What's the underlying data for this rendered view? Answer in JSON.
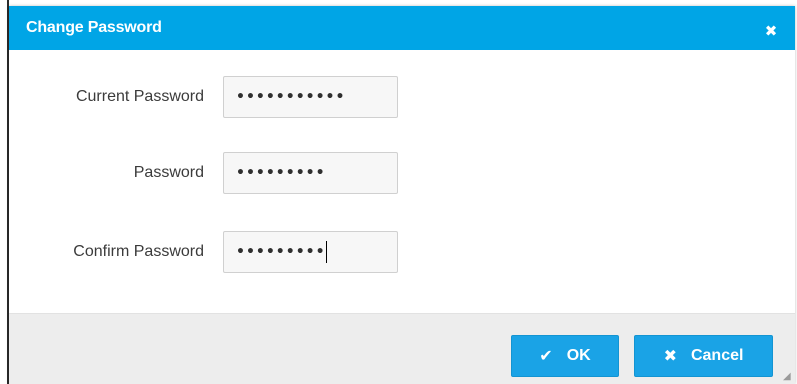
{
  "dialog": {
    "title": "Change Password",
    "close_glyph": "✖",
    "fields": [
      {
        "label": "Current Password",
        "masked_value": "•••••••••••"
      },
      {
        "label": "Password",
        "masked_value": "•••••••••"
      },
      {
        "label": "Confirm Password",
        "masked_value": "•••••••••"
      }
    ],
    "ok_label": "OK",
    "cancel_label": "Cancel",
    "ok_icon": "check-icon",
    "cancel_icon": "x-icon"
  },
  "colors": {
    "header": "#00a5e6",
    "button": "#1aa3e6",
    "footer": "#ededed"
  }
}
